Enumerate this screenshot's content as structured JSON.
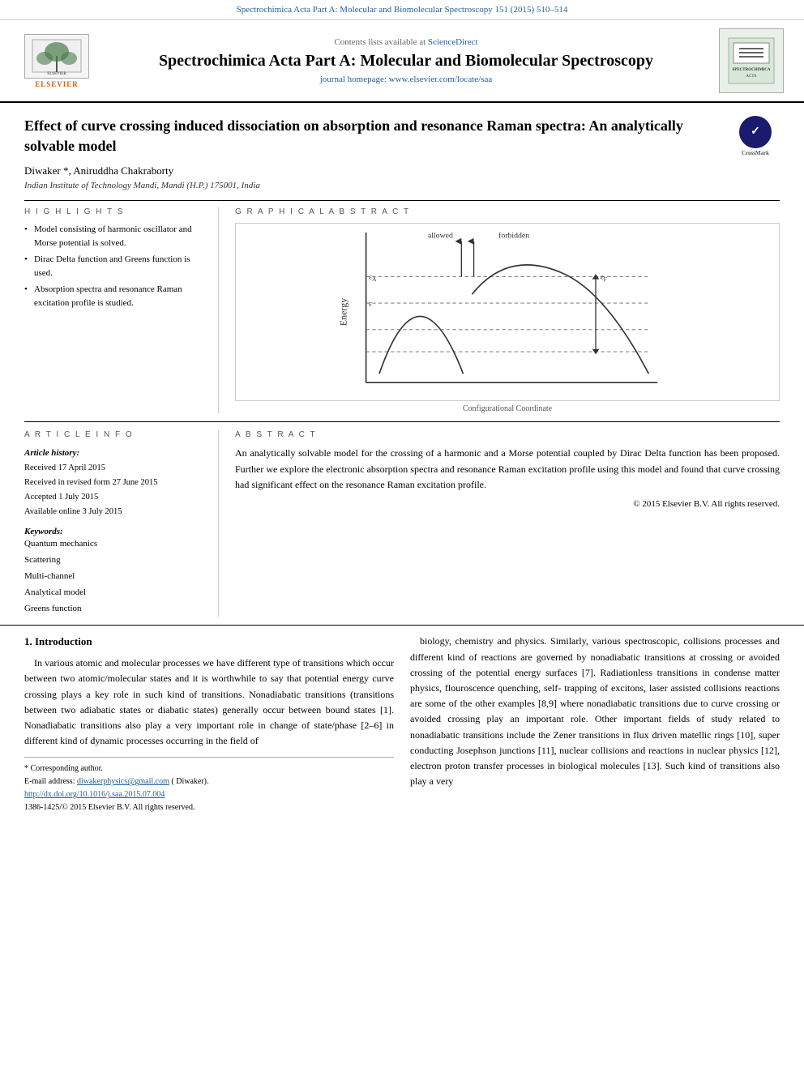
{
  "topbar": {
    "text": "Spectrochimica Acta Part A: Molecular and Biomolecular Spectroscopy 151 (2015) 510–514"
  },
  "journal": {
    "sciencedirect_label": "Contents lists available at",
    "sciencedirect_link": "ScienceDirect",
    "title": "Spectrochimica Acta Part A: Molecular and Biomolecular Spectroscopy",
    "homepage_label": "journal homepage: www.elsevier.com/locate/saa",
    "elsevier_label": "ELSEVIER",
    "spectrochimica_badge": "SPECTROCHIMICA ACTA"
  },
  "paper": {
    "title": "Effect of curve crossing induced dissociation on absorption and resonance Raman spectra: An analytically solvable model",
    "crossmark_label": "CrossMark",
    "authors": "Diwaker *, Aniruddha Chakraborty",
    "affiliation": "Indian Institute of Technology Mandi, Mandi (H.P.) 175001, India"
  },
  "highlights": {
    "heading": "H I G H L I G H T S",
    "items": [
      "Model consisting of harmonic oscillator and Morse potential is solved.",
      "Dirac Delta function and Greens function is used.",
      "Absorption spectra and resonance Raman excitation profile is studied."
    ]
  },
  "graphical_abstract": {
    "heading": "G R A P H I C A L   A B S T R A C T",
    "caption": "Configurational Coordinate",
    "y_label": "Energy",
    "curve_labels": [
      "allowed",
      "forbidden",
      "ε_A",
      "ε",
      "ε_F"
    ]
  },
  "article_info": {
    "heading": "A R T I C L E   I N F O",
    "history_label": "Article history:",
    "received": "Received 17 April 2015",
    "revised": "Received in revised form 27 June 2015",
    "accepted": "Accepted 1 July 2015",
    "available": "Available online 3 July 2015",
    "keywords_label": "Keywords:",
    "keywords": [
      "Quantum mechanics",
      "Scattering",
      "Multi-channel",
      "Analytical model",
      "Greens function"
    ]
  },
  "abstract": {
    "heading": "A B S T R A C T",
    "text": "An analytically solvable model for the crossing of a harmonic and a Morse potential coupled by Dirac Delta function has been proposed. Further we explore the electronic absorption spectra and resonance Raman excitation profile using this model and found that curve crossing had significant effect on the resonance Raman excitation profile.",
    "copyright": "© 2015 Elsevier B.V. All rights reserved."
  },
  "introduction": {
    "heading": "1. Introduction",
    "left_paragraph": "In various atomic and molecular processes we have different type of transitions which occur between two atomic/molecular states and it is worthwhile to say that potential energy curve crossing plays a key role in such kind of transitions. Nonadiabatic transitions (transitions between two adiabatic states or diabatic states) generally occur between bound states [1]. Nonadiabatic transitions also play a very important role in change of state/phase [2–6] in different kind of dynamic processes occurring in the field of",
    "right_paragraph": "biology, chemistry and physics. Similarly, various spectroscopic, collisions processes and different kind of reactions are governed by nonadiabatic transitions at crossing or avoided crossing of the potential energy surfaces [7]. Radiationless transitions in condense matter physics, flouroscence quenching, self- trapping of excitons, laser assisted collisions reactions are some of the other examples [8,9] where nonadiabatic transitions due to curve crossing or avoided crossing play an important role. Other important fields of study related to nonadiabatic transitions include the Zener transitions in flux driven matellic rings [10], super conducting Josephson junctions [11], nuclear collisions and reactions in nuclear physics [12], electron proton transfer processes in biological molecules [13]. Such kind of transitions also play a very"
  },
  "footer": {
    "corresponding_author": "* Corresponding author.",
    "email_label": "E-mail address:",
    "email": "diwakerphysics@gmail.com",
    "email_suffix": "( Diwaker).",
    "doi_link": "http://dx.doi.org/10.1016/j.saa.2015.07.004",
    "issn": "1386-1425/© 2015 Elsevier B.V. All rights reserved."
  }
}
